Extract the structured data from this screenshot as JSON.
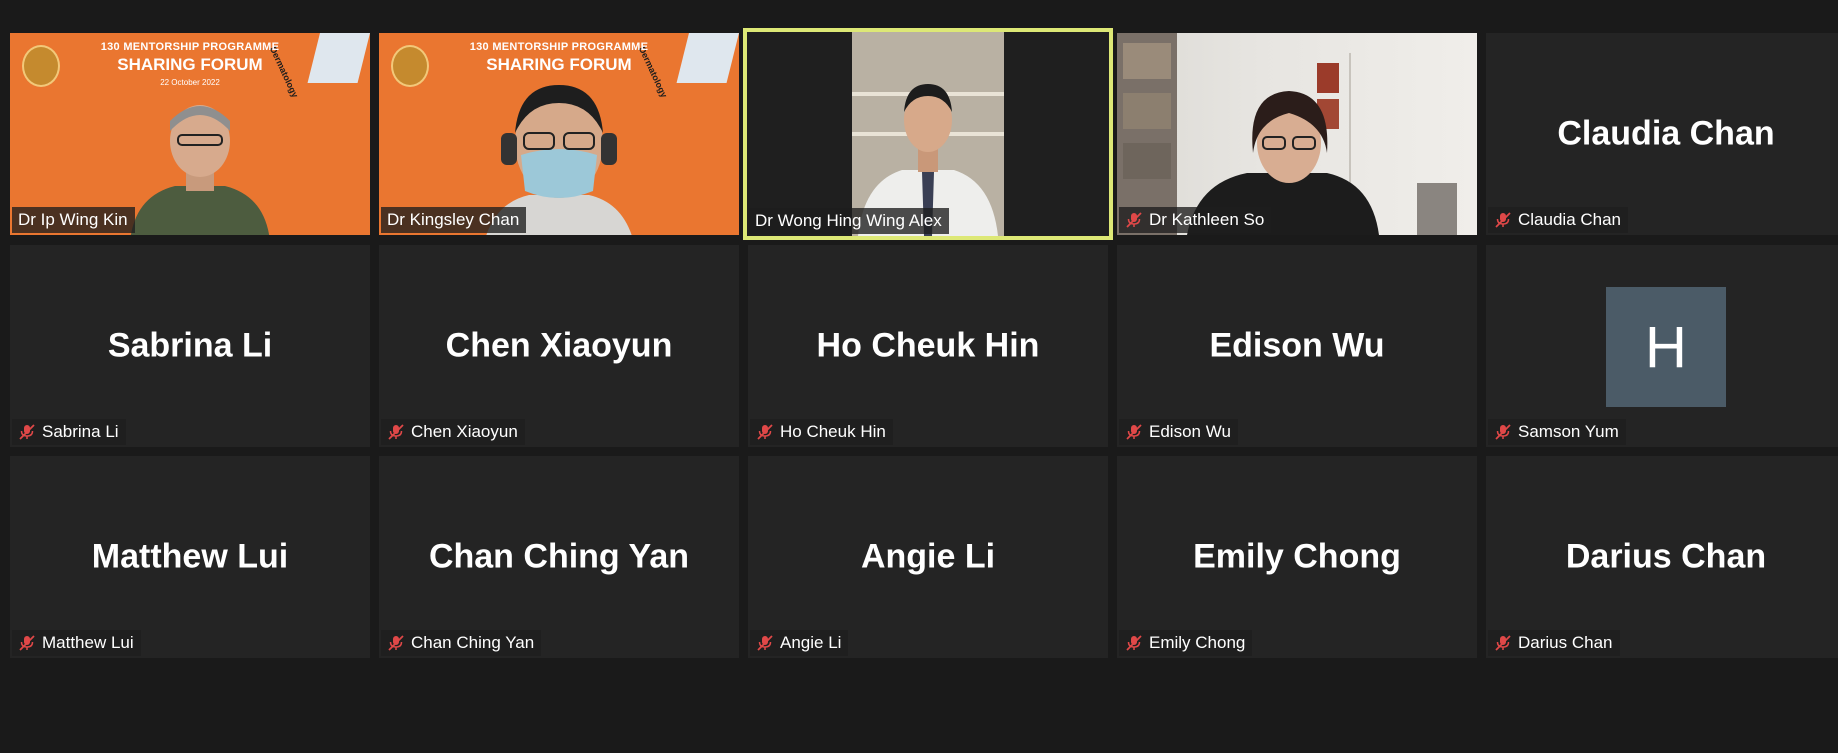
{
  "colors": {
    "background": "#1a1a1a",
    "tile_bg": "#242424",
    "active_border": "#dde876",
    "mute_icon": "#e04848",
    "avatar_bg": "#4b5b67",
    "forum_orange": "#ea7630"
  },
  "icons": {
    "mute": "microphone-muted-icon"
  },
  "forum_banner": {
    "line1": "130 MENTORSHIP PROGRAMME",
    "line2": "SHARING FORUM",
    "date": "22 October 2022",
    "side_text": "Dermatology"
  },
  "participants": [
    {
      "name": "Dr Ip Wing Kin",
      "muted": false
    },
    {
      "name": "Dr Kingsley Chan",
      "muted": false
    },
    {
      "name": "Dr Wong Hing Wing Alex",
      "muted": false,
      "active_speaker": true
    },
    {
      "name": "Dr Kathleen So",
      "muted": true
    },
    {
      "name": "Claudia Chan",
      "display": "Claudia Chan",
      "muted": true
    },
    {
      "name": "Sabrina Li",
      "display": "Sabrina Li",
      "muted": true
    },
    {
      "name": "Chen Xiaoyun",
      "display": "Chen Xiaoyun",
      "muted": true
    },
    {
      "name": "Ho Cheuk Hin",
      "display": "Ho Cheuk Hin",
      "muted": true
    },
    {
      "name": "Edison Wu",
      "display": "Edison Wu",
      "muted": true
    },
    {
      "name": "Samson Yum",
      "avatar_letter": "H",
      "muted": true
    },
    {
      "name": "Matthew Lui",
      "display": "Matthew Lui",
      "muted": true
    },
    {
      "name": "Chan Ching Yan",
      "display": "Chan Ching Yan",
      "muted": true
    },
    {
      "name": "Angie Li",
      "display": "Angie Li",
      "muted": true
    },
    {
      "name": "Emily Chong",
      "display": "Emily Chong",
      "muted": true
    },
    {
      "name": "Darius Chan",
      "display": "Darius Chan",
      "muted": true
    }
  ]
}
